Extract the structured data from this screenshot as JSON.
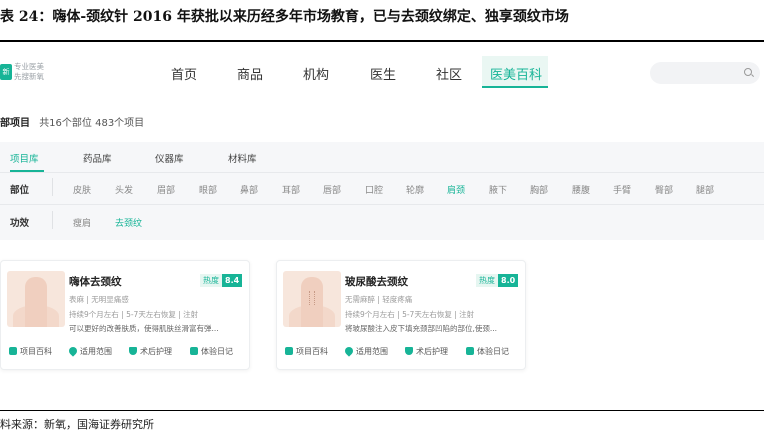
{
  "figure": {
    "title": "表 24：嗨体-颈纹针 2016 年获批以来历经多年市场教育，已与去颈纹绑定、独享颈纹市场",
    "source": "料来源：新氧，国海证券研究所"
  },
  "logo": {
    "badge": "新氧",
    "line1": "专业医美",
    "line2": "先搜新氧"
  },
  "nav": {
    "items": [
      "首页",
      "商品",
      "机构",
      "医生",
      "社区",
      "医美百科"
    ],
    "active_index": 5
  },
  "summary": {
    "title": "部项目",
    "count": "共16个部位 483个项目"
  },
  "tabs": [
    "项目库",
    "药品库",
    "仪器库",
    "材料库"
  ],
  "filters": {
    "part_label": "部位",
    "parts": [
      "皮肤",
      "头发",
      "眉部",
      "眼部",
      "鼻部",
      "耳部",
      "唇部",
      "口腔",
      "轮廓",
      "肩颈",
      "腋下",
      "胸部",
      "腰腹",
      "手臂",
      "臀部",
      "腿部"
    ],
    "part_active": "肩颈",
    "effect_label": "功效",
    "effects": [
      "瘦肩",
      "去颈纹"
    ],
    "effect_active": "去颈纹"
  },
  "cards": [
    {
      "title": "嗨体去颈纹",
      "hot_label": "热度",
      "hot_score": "8.4",
      "tags": "表麻 | 无明显痛感",
      "duration": "持续9个月左右 | 5-7天左右恢复 | 注射",
      "desc": "可以更好的改善肤质，使得肌肤丝滑富有弹..."
    },
    {
      "title": "玻尿酸去颈纹",
      "hot_label": "热度",
      "hot_score": "8.0",
      "tags": "无需麻醉 | 轻度疼痛",
      "duration": "持续9个月左右 | 5-7天左右恢复 | 注射",
      "desc": "将玻尿酸注入皮下填充颈部凹陷的部位,使颈..."
    }
  ],
  "card_actions": [
    "项目百科",
    "适用范围",
    "术后护理",
    "体验日记"
  ],
  "colors": {
    "accent": "#17b497",
    "panel_bg": "#f6f7f9"
  },
  "icons": {
    "search": "search-icon",
    "actions": [
      "book-icon",
      "location-pin-icon",
      "shield-icon",
      "diary-icon"
    ]
  }
}
